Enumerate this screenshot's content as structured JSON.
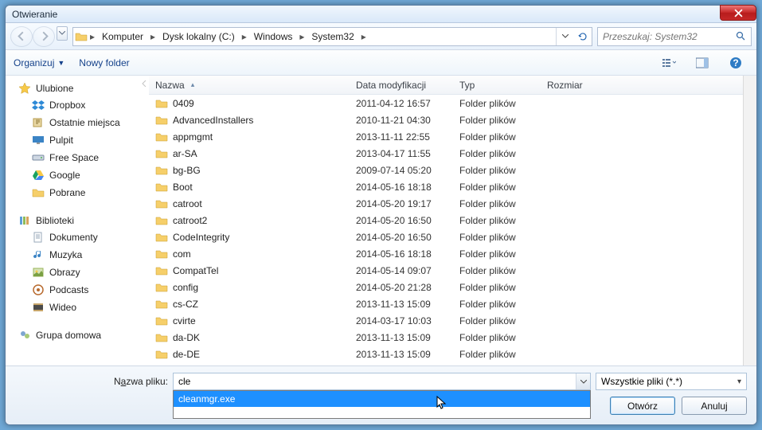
{
  "window": {
    "title": "Otwieranie"
  },
  "path": {
    "segments": [
      "Komputer",
      "Dysk lokalny (C:)",
      "Windows",
      "System32"
    ]
  },
  "search": {
    "placeholder": "Przeszukaj: System32"
  },
  "toolbar": {
    "organize": "Organizuj",
    "new_folder": "Nowy folder"
  },
  "sidebar": {
    "fav_head": "Ulubione",
    "fav_items": [
      "Dropbox",
      "Ostatnie miejsca",
      "Pulpit",
      "Free Space",
      "Google",
      "Pobrane"
    ],
    "lib_head": "Biblioteki",
    "lib_items": [
      "Dokumenty",
      "Muzyka",
      "Obrazy",
      "Podcasts",
      "Wideo"
    ],
    "homegroup": "Grupa domowa"
  },
  "columns": {
    "name": "Nazwa",
    "date": "Data modyfikacji",
    "type": "Typ",
    "size": "Rozmiar"
  },
  "rows": [
    {
      "name": "0409",
      "date": "2011-04-12 16:57",
      "type": "Folder plików"
    },
    {
      "name": "AdvancedInstallers",
      "date": "2010-11-21 04:30",
      "type": "Folder plików"
    },
    {
      "name": "appmgmt",
      "date": "2013-11-11 22:55",
      "type": "Folder plików"
    },
    {
      "name": "ar-SA",
      "date": "2013-04-17 11:55",
      "type": "Folder plików"
    },
    {
      "name": "bg-BG",
      "date": "2009-07-14 05:20",
      "type": "Folder plików"
    },
    {
      "name": "Boot",
      "date": "2014-05-16 18:18",
      "type": "Folder plików"
    },
    {
      "name": "catroot",
      "date": "2014-05-20 19:17",
      "type": "Folder plików"
    },
    {
      "name": "catroot2",
      "date": "2014-05-20 16:50",
      "type": "Folder plików"
    },
    {
      "name": "CodeIntegrity",
      "date": "2014-05-20 16:50",
      "type": "Folder plików"
    },
    {
      "name": "com",
      "date": "2014-05-16 18:18",
      "type": "Folder plików"
    },
    {
      "name": "CompatTel",
      "date": "2014-05-14 09:07",
      "type": "Folder plików"
    },
    {
      "name": "config",
      "date": "2014-05-20 21:28",
      "type": "Folder plików"
    },
    {
      "name": "cs-CZ",
      "date": "2013-11-13 15:09",
      "type": "Folder plików"
    },
    {
      "name": "cvirte",
      "date": "2014-03-17 10:03",
      "type": "Folder plików"
    },
    {
      "name": "da-DK",
      "date": "2013-11-13 15:09",
      "type": "Folder plików"
    },
    {
      "name": "de-DE",
      "date": "2013-11-13 15:09",
      "type": "Folder plików"
    }
  ],
  "footer": {
    "name_label_pre": "N",
    "name_label_u": "a",
    "name_label_post": "zwa pliku:",
    "name_value": "cle",
    "autocomplete": "cleanmgr.exe",
    "type_filter": "Wszystkie pliki (*.*)",
    "open": "Otwórz",
    "cancel": "Anuluj"
  }
}
